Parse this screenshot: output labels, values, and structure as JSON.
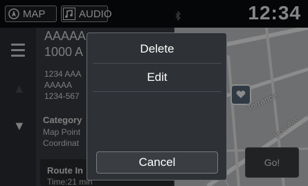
{
  "status_bar": {
    "map_label": "MAP",
    "audio_label": "AUDIO",
    "clock": "12:34"
  },
  "place": {
    "name": "AAAAA",
    "address_line": "1000 A",
    "detail_lines": [
      "1234 AAA",
      "AAAAA",
      "1234-567"
    ],
    "category_label": "Category",
    "info_lines": [
      "Map Point",
      "Coordinat"
    ],
    "route_label": "Route In",
    "route_time": "Time:21 min"
  },
  "map": {
    "street_labels": [
      "Torrance",
      "Bow Ave"
    ]
  },
  "go_label": "Go!",
  "popup": {
    "items": [
      "Delete",
      "Edit"
    ],
    "cancel_label": "Cancel"
  },
  "colors": {
    "background": "#1a1c20",
    "popup": "#2e3135",
    "map": "#c7c9cc"
  }
}
